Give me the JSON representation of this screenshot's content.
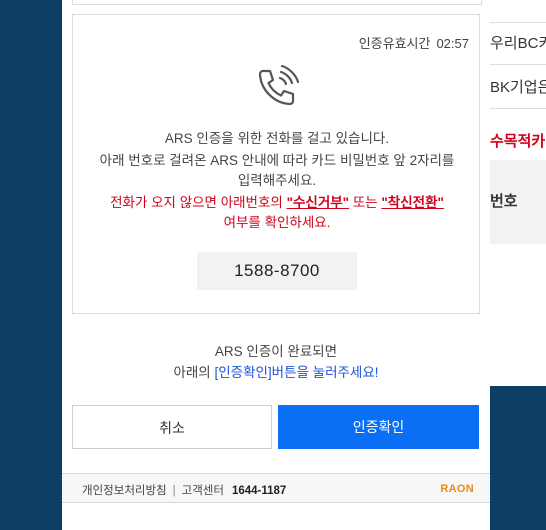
{
  "background": {
    "rows": [
      "",
      "우리BC카",
      "BK기업은",
      "수목적카",
      "번호"
    ]
  },
  "timer": {
    "label": "인증유효시간",
    "value": "02:57"
  },
  "message": {
    "line1": "ARS 인증을 위한 전화를 걸고 있습니다.",
    "line2a": "아래 번호로 걸려온 ARS 안내에 따라 카드 비밀번호 앞 2자리를",
    "line2b": "입력해주세요.",
    "warn_pre": "전화가 오지 않으면 아래번호의 ",
    "warn_hl1": "\"수신거부\"",
    "warn_mid": " 또는 ",
    "warn_hl2": "\"착신전환\"",
    "warn_post": "여부를 확인하세요."
  },
  "phone_number": "1588-8700",
  "complete": {
    "line1": "ARS 인증이 완료되면",
    "line2_pre": "아래의 ",
    "line2_blue": "[인증확인]버튼을 눌러주세요!"
  },
  "buttons": {
    "cancel": "취소",
    "confirm": "인증확인"
  },
  "footer": {
    "privacy": "개인정보처리방침",
    "separator": "|",
    "center": "고객센터",
    "phone": "1644-1187",
    "logo": "RAON"
  },
  "icons": {
    "phone": "phone-ringing-icon"
  },
  "colors": {
    "primary": "#0a6ff5",
    "warning": "#d0021b",
    "link": "#1a55d8",
    "logo": "#e88a1a"
  }
}
